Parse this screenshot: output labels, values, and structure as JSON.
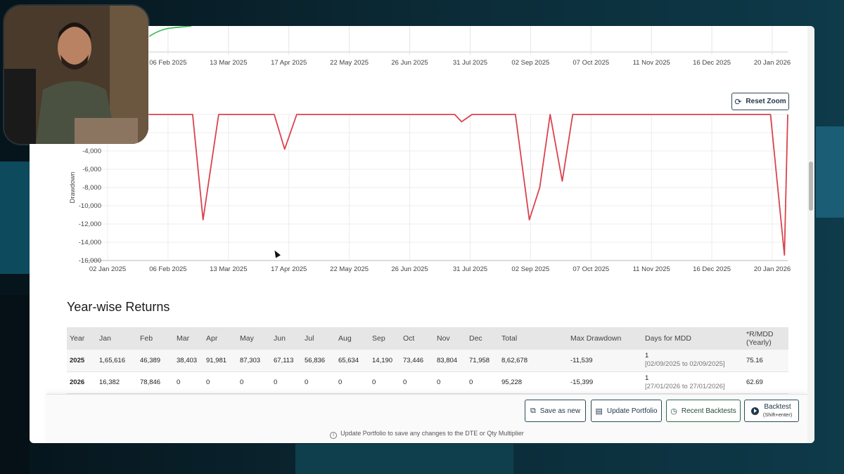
{
  "top_chart": {
    "x_tick_labels": [
      "06 Feb 2025",
      "13 Mar 2025",
      "17 Apr 2025",
      "22 May 2025",
      "26 Jun 2025",
      "31 Jul 2025",
      "02 Sep 2025",
      "07 Oct 2025",
      "11 Nov 2025",
      "16 Dec 2025",
      "20 Jan 2026"
    ],
    "series_color": "#2db84d"
  },
  "drawdown_chart": {
    "reset_zoom_label": "Reset Zoom",
    "ylabel": "Drawdown",
    "y_tick_labels": [
      "-4,000",
      "-6,000",
      "-8,000",
      "-10,000",
      "-12,000",
      "-14,000",
      "-16,000"
    ],
    "x_tick_labels": [
      "02 Jan 2025",
      "06 Feb 2025",
      "13 Mar 2025",
      "17 Apr 2025",
      "22 May 2025",
      "26 Jun 2025",
      "31 Jul 2025",
      "02 Sep 2025",
      "07 Oct 2025",
      "11 Nov 2025",
      "16 Dec 2025",
      "20 Jan 2026"
    ],
    "line_color": "#d9434e"
  },
  "chart_data": {
    "type": "line",
    "xlabel": "",
    "ylabel": "Drawdown",
    "x": [
      "2025-01-02",
      "2025-02-20",
      "2025-02-26",
      "2025-03-07",
      "2025-04-08",
      "2025-04-14",
      "2025-04-21",
      "2025-07-21",
      "2025-07-25",
      "2025-07-31",
      "2025-08-25",
      "2025-09-02",
      "2025-09-08",
      "2025-09-14",
      "2025-09-21",
      "2025-09-27",
      "2025-12-31",
      "2026-01-19",
      "2026-01-27",
      "2026-02-02",
      "2026-02-08"
    ],
    "values": [
      0,
      0,
      -11539,
      0,
      0,
      -3800,
      0,
      0,
      -800,
      0,
      0,
      -11539,
      -8000,
      0,
      -7300,
      0,
      0,
      0,
      -15399,
      0,
      0
    ],
    "ylim": [
      -16000,
      0
    ],
    "grid": true
  },
  "returns": {
    "title": "Year-wise Returns",
    "columns": [
      "Year",
      "Jan",
      "Feb",
      "Mar",
      "Apr",
      "May",
      "Jun",
      "Jul",
      "Aug",
      "Sep",
      "Oct",
      "Nov",
      "Dec",
      "Total",
      "Max Drawdown",
      "Days for MDD",
      "*R/MDD (Yearly)"
    ],
    "rows": [
      {
        "year": "2025",
        "months": [
          "1,65,616",
          "46,389",
          "38,403",
          "91,981",
          "87,303",
          "67,113",
          "56,836",
          "65,634",
          "14,190",
          "73,446",
          "83,804",
          "71,958"
        ],
        "total": "8,62,678",
        "max_dd": "-11,539",
        "days": "1",
        "range": "[02/09/2025 to 02/09/2025]",
        "rmdd": "75.16"
      },
      {
        "year": "2026",
        "months": [
          "16,382",
          "78,846",
          "0",
          "0",
          "0",
          "0",
          "0",
          "0",
          "0",
          "0",
          "0",
          "0"
        ],
        "total": "95,228",
        "max_dd": "-15,399",
        "days": "1",
        "range": "[27/01/2026 to 27/01/2026]",
        "rmdd": "62.69"
      }
    ]
  },
  "footer": {
    "save_as_new": "Save as new",
    "update_portfolio": "Update Portfolio",
    "recent_backtests": "Recent Backtests",
    "backtest": "Backtest",
    "backtest_shortcut": "(Shift+enter)",
    "note": "Update Portfolio to save any changes to the DTE or Qty Multiplier"
  }
}
